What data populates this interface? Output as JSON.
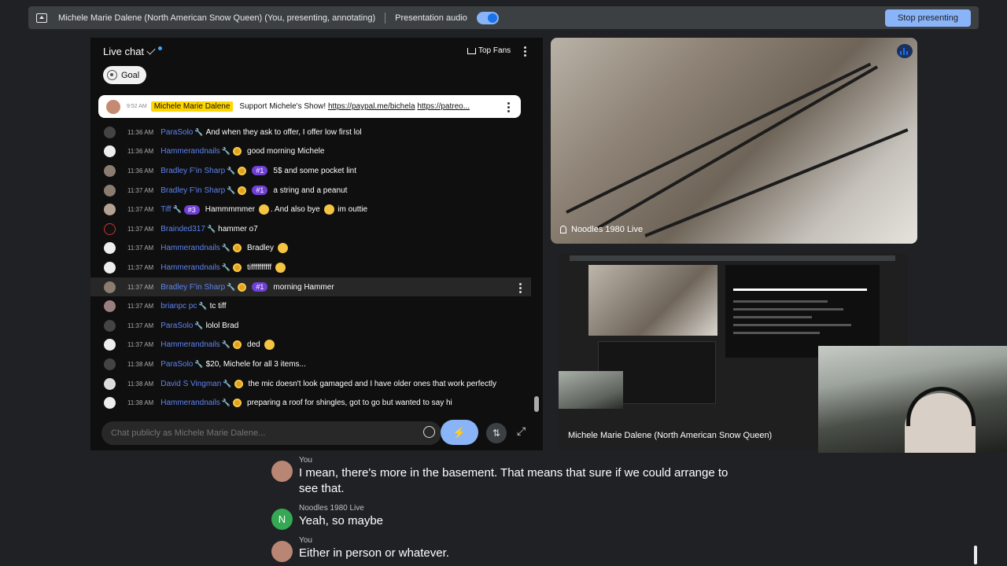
{
  "topbar": {
    "presenter": "Michele Marie Dalene (North American Snow Queen) (You, presenting, annotating)",
    "audio_label": "Presentation audio",
    "stop_label": "Stop presenting"
  },
  "chat": {
    "title": "Live chat",
    "top_fans": "Top Fans",
    "goal": "Goal",
    "pinned": {
      "time": "9:52 AM",
      "author": "Michele Marie Dalene",
      "text": "Support Michele's Show! ",
      "link1": "https://paypal.me/bichela",
      "link2": "https://patreo..."
    },
    "messages": [
      {
        "time": "11:36 AM",
        "author": "ParaSolo",
        "text": "And when they ask to offer, I offer low first lol"
      },
      {
        "time": "11:36 AM",
        "author": "Hammerandnails",
        "text": "good morning Michele"
      },
      {
        "time": "11:36 AM",
        "author": "Bradley F'in Sharp",
        "badge": "#1",
        "text": "5$ and some pocket lint"
      },
      {
        "time": "11:37 AM",
        "author": "Bradley F'in Sharp",
        "badge": "#1",
        "text": "a string and a peanut"
      },
      {
        "time": "11:37 AM",
        "author": "Tiff",
        "badge": "#3",
        "text": "Hammmmmer",
        "text_b": ". And also bye",
        "text_c": "im outtie"
      },
      {
        "time": "11:37 AM",
        "author": "Brainded317",
        "text": "hammer o7"
      },
      {
        "time": "11:37 AM",
        "author": "Hammerandnails",
        "text": "Bradley"
      },
      {
        "time": "11:37 AM",
        "author": "Hammerandnails",
        "text": "tiffffffffff"
      },
      {
        "time": "11:37 AM",
        "author": "Bradley F'in Sharp",
        "badge": "#1",
        "text": "morning Hammer"
      },
      {
        "time": "11:37 AM",
        "author": "brianpc pc",
        "text": "tc tiff"
      },
      {
        "time": "11:37 AM",
        "author": "ParaSolo",
        "text": "lolol Brad"
      },
      {
        "time": "11:37 AM",
        "author": "Hammerandnails",
        "text": "ded"
      },
      {
        "time": "11:38 AM",
        "author": "ParaSolo",
        "text": "$20, Michele for all 3 items..."
      },
      {
        "time": "11:38 AM",
        "author": "David S Vingman",
        "text": "the mic doesn't look gamaged and I have older ones that work perfectly"
      },
      {
        "time": "11:38 AM",
        "author": "Hammerandnails",
        "text": "preparing a roof for shingles, got to go but wanted to say hi"
      }
    ],
    "input_placeholder": "Chat publicly as Michele Marie Dalene..."
  },
  "video": {
    "participant": "Noodles 1980 Live"
  },
  "screen_tile": {
    "name": "Michele Marie Dalene (North American Snow Queen)"
  },
  "captions": [
    {
      "who": "You",
      "said": "I mean, there's more in the basement. That means that sure if we could arrange to see that."
    },
    {
      "who": "Noodles 1980 Live",
      "initial": "N",
      "said": "Yeah, so maybe"
    },
    {
      "who": "You",
      "said": "Either in person or whatever."
    }
  ],
  "colors": {
    "accent": "#8ab4f8",
    "author_blue": "#5e84f1",
    "owner_badge": "#ffd600",
    "member_badge": "#6f3fd6"
  }
}
